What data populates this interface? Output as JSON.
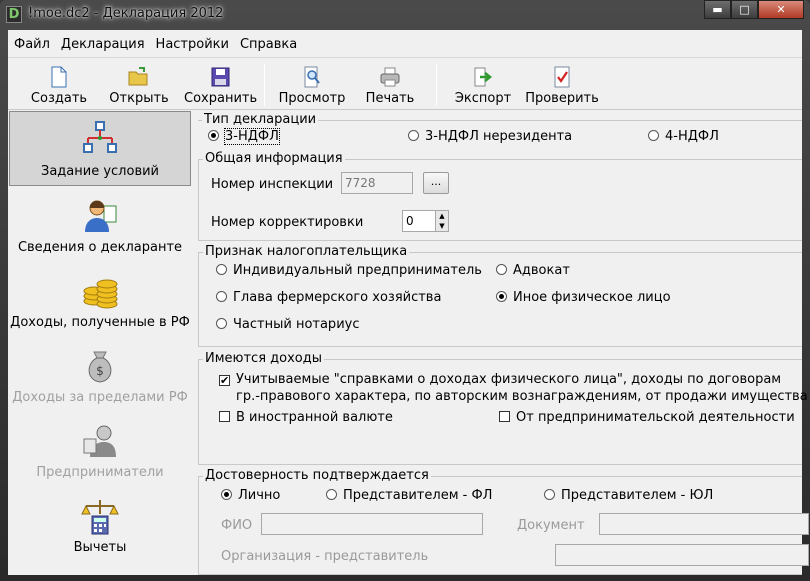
{
  "window": {
    "title": "!moe.dc2 - Декларация 2012",
    "app_icon": "D",
    "minimize": "▬",
    "maximize": "□",
    "close": "✕"
  },
  "menu": [
    "Файл",
    "Декларация",
    "Настройки",
    "Справка"
  ],
  "toolbar": [
    {
      "label": "Создать",
      "icon": "new-document-icon"
    },
    {
      "label": "Открыть",
      "icon": "open-folder-icon"
    },
    {
      "label": "Сохранить",
      "icon": "floppy-disk-icon"
    },
    {
      "label": "Просмотр",
      "icon": "preview-magnifier-icon"
    },
    {
      "label": "Печать",
      "icon": "printer-icon"
    },
    {
      "label": "Экспорт",
      "icon": "export-icon"
    },
    {
      "label": "Проверить",
      "icon": "check-document-icon"
    }
  ],
  "sidebar": [
    {
      "label": "Задание условий",
      "icon": "structure-diagram-icon",
      "selected": true,
      "enabled": true
    },
    {
      "label": "Сведения о декларанте",
      "icon": "person-icon",
      "selected": false,
      "enabled": true
    },
    {
      "label": "Доходы, полученные в РФ",
      "icon": "coins-icon",
      "selected": false,
      "enabled": true
    },
    {
      "label": "Доходы за пределами РФ",
      "icon": "money-bag-icon",
      "selected": false,
      "enabled": false
    },
    {
      "label": "Предприниматели",
      "icon": "businessman-icon",
      "selected": false,
      "enabled": false
    },
    {
      "label": "Вычеты",
      "icon": "scales-calculator-icon",
      "selected": false,
      "enabled": true
    }
  ],
  "decl_type": {
    "legend": "Тип декларации",
    "options": [
      "3-НДФЛ",
      "3-НДФЛ нерезидента",
      "4-НДФЛ"
    ],
    "selected": 0
  },
  "general": {
    "legend": "Общая информация",
    "inspection_label": "Номер инспекции",
    "inspection_value": "7728",
    "browse_button": "...",
    "correction_label": "Номер корректировки",
    "correction_value": "0"
  },
  "taxpayer": {
    "legend": "Признак налогоплательщика",
    "options": [
      "Индивидуальный предприниматель",
      "Адвокат",
      "Глава фермерского хозяйства",
      "Иное физическое лицо",
      "Частный нотариус"
    ],
    "selected": 3
  },
  "income": {
    "legend": "Имеются доходы",
    "opt1_line1": "Учитываемые \"справками о доходах физического лица\", доходы по договорам",
    "opt1_line2": "гр.-правового характера, по авторским вознаграждениям, от продажи имущества и др.",
    "opt1_checked": true,
    "opt2": "В иностранной валюте",
    "opt2_checked": false,
    "opt3": "От предпринимательской деятельности",
    "opt3_checked": false
  },
  "confirm": {
    "legend": "Достоверность подтверждается",
    "options": [
      "Лично",
      "Представителем - ФЛ",
      "Представителем - ЮЛ"
    ],
    "selected": 0,
    "fio_label": "ФИО",
    "doc_label": "Документ",
    "org_label": "Организация - представитель"
  }
}
